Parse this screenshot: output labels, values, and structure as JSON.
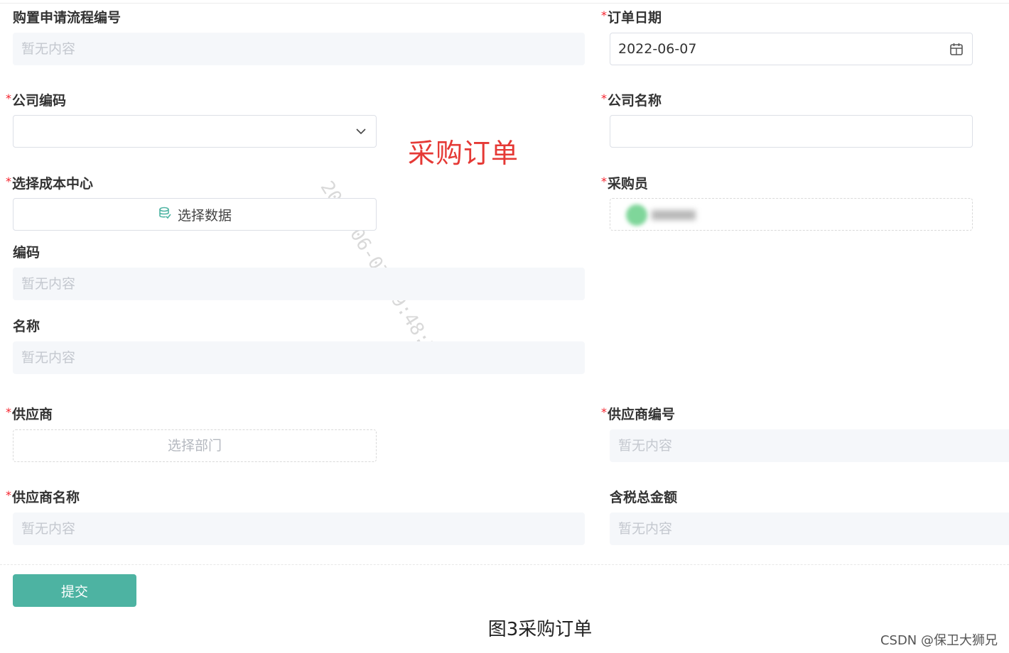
{
  "form": {
    "request_no": {
      "label": "购置申请流程编号",
      "placeholder": "暂无内容"
    },
    "order_date": {
      "label": "订单日期",
      "value": "2022-06-07"
    },
    "company_code": {
      "label": "公司编码",
      "value": ""
    },
    "company_name": {
      "label": "公司名称",
      "value": ""
    },
    "cost_center": {
      "label": "选择成本中心",
      "button": "选择数据"
    },
    "purchaser": {
      "label": "采购员"
    },
    "code": {
      "label": "编码",
      "placeholder": "暂无内容"
    },
    "name": {
      "label": "名称",
      "placeholder": "暂无内容"
    },
    "supplier": {
      "label": "供应商",
      "button": "选择部门"
    },
    "supplier_no": {
      "label": "供应商编号",
      "placeholder": "暂无内容"
    },
    "supplier_name": {
      "label": "供应商名称",
      "placeholder": "暂无内容"
    },
    "total_with_tax": {
      "label": "含税总金额",
      "placeholder": "暂无内容"
    },
    "submit": "提交"
  },
  "required_mark": "*",
  "overlay_title": "采购订单",
  "watermark": {
    "line1": "",
    "line2": "2022-06-07 09:48:20"
  },
  "caption": "图3采购订单",
  "credit": "CSDN @保卫大狮兄",
  "colors": {
    "accent": "#4db3a2",
    "required": "#f5222d",
    "overlay_title": "#e53935"
  }
}
